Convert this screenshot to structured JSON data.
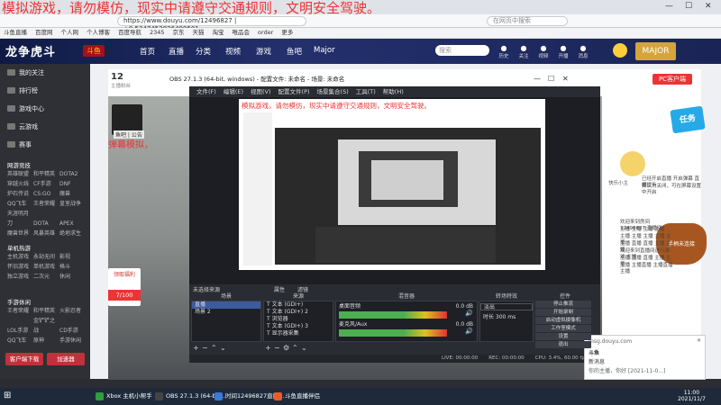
{
  "overlay_text": "模拟游戏，请勿模仿，现实中请遵守交通规则，文明安全驾驶。",
  "browser": {
    "url": "https://www.douyu.com/12496827 | +0.5347452826499501",
    "search_placeholder": "在网页中搜索",
    "bookmarks": [
      "斗鱼直播",
      "百度网",
      "个人网",
      "个人博客",
      "百度导航",
      "2345",
      "京东",
      "天猫",
      "淘宝",
      "唯品会",
      "order",
      "更多"
    ]
  },
  "douyu": {
    "logo": "龙争虎斗",
    "logo_badge": "斗鱼",
    "nav": [
      "首页",
      "直播",
      "分类",
      "视频",
      "游戏",
      "鱼吧",
      "Major"
    ],
    "search_placeholder": "搜索",
    "header_icons": [
      {
        "icon": "history-icon",
        "label": "历史"
      },
      {
        "icon": "follow-icon",
        "label": "关注"
      },
      {
        "icon": "video-icon",
        "label": "视频"
      },
      {
        "icon": "live-icon",
        "label": "开播"
      },
      {
        "icon": "msg-icon",
        "label": "消息"
      }
    ],
    "major_label": "MAJOR",
    "sidebar": {
      "items": [
        "我的关注",
        "排行榜",
        "游戏中心",
        "云游戏",
        "赛事"
      ],
      "section_titles": [
        "网游竞技",
        "单机热游",
        "手游休闲"
      ],
      "grid1": [
        "英雄联盟",
        "和平精英",
        "DOTA2",
        "穿越火线",
        "CF手游",
        "DNF",
        "炉石传说",
        "CS:GO",
        "魔兽",
        "QQ飞车",
        "王者荣耀",
        "皇室战争",
        "天涯明月刀",
        "DOTA",
        "APEX",
        "魔兽世界",
        "风暴英雄",
        "绝地求生"
      ],
      "grid2": [
        "主机游戏",
        "永劫无间",
        "影视",
        "怀旧游戏",
        "单机游戏",
        "格斗",
        "独立游戏",
        "二次元",
        "休闲"
      ],
      "grid3": [
        "王者荣耀",
        "和平精英",
        "火影忍者",
        "LOL手游",
        "金铲铲之战",
        "CD手游",
        "QQ飞车",
        "原神",
        "手游休闲"
      ],
      "btn_primary": "客户端下载",
      "btn_secondary": "加速器"
    },
    "room": {
      "fans": "12",
      "fans_label": "主播粉丝",
      "streamer_name": "鱼吧 | 公告",
      "red_text": "弹幕模拟，"
    },
    "pc_client": "PC客户端",
    "right_texts": [
      "已经开启直播 开启弹幕 直播提示",
      "默认为关闭，可在屏幕设置中开启",
      "欢迎来到房间12496827 直播间",
      "主播 主播 主播 主播",
      "主播 主播 主播 主播 主播",
      "主播 直播 直播 主播 主播",
      "欢迎来到直播间进行游戏 主播",
      "主播 直播 直播 主播 主播",
      "主播 主播直播 主播直播 主播"
    ],
    "right_sticker": "任务",
    "char_label": "快乐小主",
    "gamepad_label": "手柄未连接",
    "gift": {
      "label": "领取福利",
      "count": "7/100"
    }
  },
  "obs": {
    "title": "OBS 27.1.3 (64-bit, windows) - 配置文件: 未命名 - 场景: 未命名",
    "menu": [
      "文件(F)",
      "编辑(E)",
      "视图(V)",
      "配置文件(P)",
      "场景集合(S)",
      "工具(T)",
      "帮助(H)"
    ],
    "preview_red": "模拟游戏，请勿模仿，现实中请遵守交通规则，文明安全驾驶。",
    "unselected": "未选择来源",
    "props_label": "属性",
    "filters_label": "滤镜",
    "docks": [
      "场景",
      "来源",
      "混音器",
      "转场特效",
      "控件"
    ],
    "scenes": [
      "直播",
      "场景 2"
    ],
    "sources": [
      "文本 (GDI+)",
      "文本 (GDI+) 2",
      "浏览器",
      "文本 (GDI+) 3",
      "显示器采集"
    ],
    "mixer": [
      {
        "name": "桌面音频",
        "db": "0.0 dB"
      },
      {
        "name": "麦克风/Aux",
        "db": "0.0 dB"
      }
    ],
    "transition": {
      "type": "淡出",
      "duration_label": "时长",
      "duration": "300 ms"
    },
    "controls": [
      "停止推流",
      "开始录制",
      "启动虚拟摄像机",
      "工作室模式",
      "设置",
      "退出"
    ],
    "status": [
      "LIVE: 00:00:00",
      "REC: 00:00:00",
      "CPU: 3.4%, 60.00 fps"
    ]
  },
  "notification": {
    "site": "msg.douyu.com",
    "title": "斗鱼",
    "body1": "新消息",
    "body2": "你的主播，你好 [2021-11-0...]"
  },
  "taskbar": {
    "items": [
      {
        "label": "Xbox 主机小帮手",
        "color": "#2e9e3f"
      },
      {
        "label": "OBS 27.1.3 (64-bit...",
        "color": "#444444"
      },
      {
        "label": "时间12496827直播...",
        "color": "#3979d8"
      },
      {
        "label": "斗鱼直播伴侣",
        "color": "#e95d2a"
      }
    ],
    "time": "11:00",
    "date": "2021/11/7"
  }
}
